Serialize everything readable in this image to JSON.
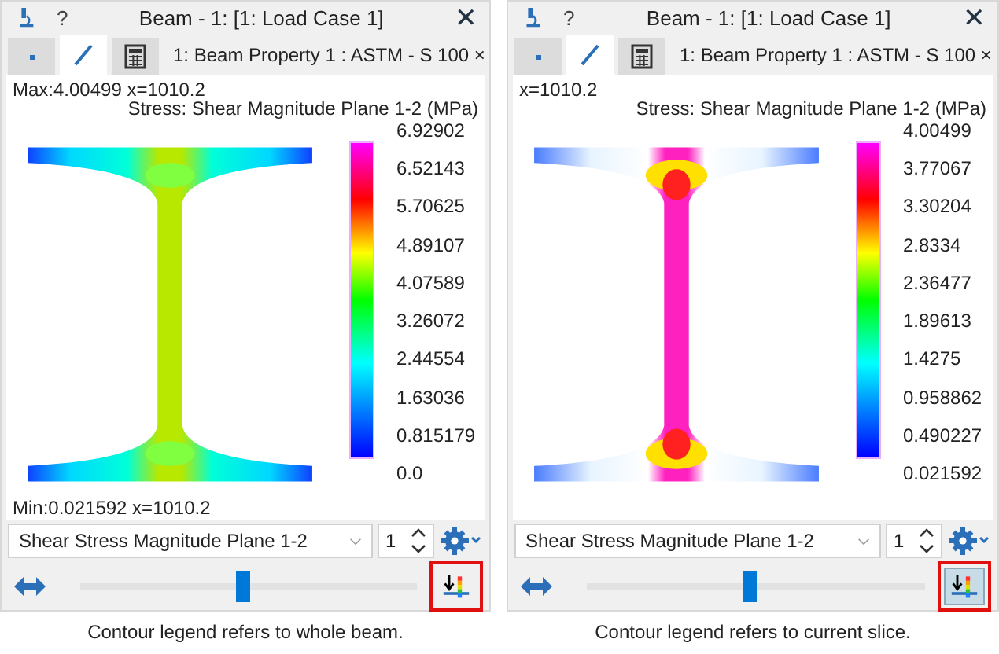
{
  "panels": [
    {
      "title": "Beam - 1: [1: Load Case 1]",
      "help": "?",
      "close": "✕",
      "tabs": [
        {
          "kind": "dot",
          "selected": false
        },
        {
          "kind": "line",
          "selected": true
        },
        {
          "kind": "calculator",
          "selected": false
        }
      ],
      "property_tab": "1: Beam Property 1 : ASTM - S 100 ×",
      "top_label": "Max:4.00499 x=1010.2",
      "legend_title": "Stress: Shear Magnitude Plane 1-2 (MPa)",
      "legend_values": [
        "6.92902",
        "6.52143",
        "5.70625",
        "4.89107",
        "4.07589",
        "3.26072",
        "2.44554",
        "1.63036",
        "0.815179",
        "0.0"
      ],
      "bottom_label": "Min:0.021592 x=1010.2",
      "result_type": "Shear Stress Magnitude Plane 1-2",
      "slice": "1",
      "slider": {
        "level": 0.48
      },
      "legend_toggle": {
        "selected": false
      },
      "caption": "Contour legend refers to whole beam."
    },
    {
      "title": "Beam - 1: [1: Load Case 1]",
      "help": "?",
      "close": "✕",
      "tabs": [
        {
          "kind": "dot",
          "selected": false
        },
        {
          "kind": "line",
          "selected": true
        },
        {
          "kind": "calculator",
          "selected": false
        }
      ],
      "property_tab": "1: Beam Property 1 : ASTM - S 100 ×",
      "top_label": "x=1010.2",
      "legend_title": "Stress: Shear Magnitude Plane 1-2 (MPa)",
      "legend_values": [
        "4.00499",
        "3.77067",
        "3.30204",
        "2.8334",
        "2.36477",
        "1.89613",
        "1.4275",
        "0.958862",
        "0.490227",
        "0.021592"
      ],
      "result_type": "Shear Stress Magnitude Plane 1-2",
      "slice": "1",
      "slider": {
        "level": 0.48
      },
      "legend_toggle": {
        "selected": true
      },
      "caption": "Contour legend refers to current slice."
    }
  ]
}
